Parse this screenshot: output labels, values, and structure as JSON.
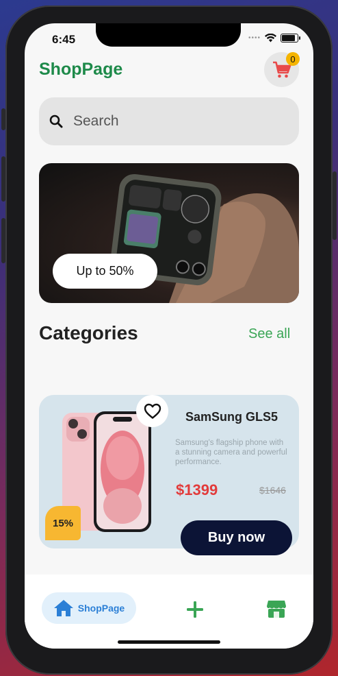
{
  "status_bar": {
    "time": "6:45"
  },
  "header": {
    "title": "ShopPage",
    "cart_count": "0"
  },
  "search": {
    "placeholder": "Search"
  },
  "banner": {
    "button_label": "Up to 50%"
  },
  "categories": {
    "title": "Categories",
    "see_all": "See all"
  },
  "product": {
    "name": "SamSung GLS5",
    "description": "Samsung's flagship phone with a stunning camera and powerful performance.",
    "price": "$1399",
    "old_price": "$1646",
    "discount": "15%",
    "buy_label": "Buy now"
  },
  "bottom_nav": {
    "home_label": "ShopPage",
    "home_icon": "home-icon",
    "add_icon": "plus-icon",
    "store_icon": "store-icon"
  },
  "colors": {
    "brand_green": "#1e8a4a",
    "link_green": "#3aa555",
    "price_red": "#e23b3b",
    "buy_button": "#0c1436",
    "badge_yellow": "#f5b400",
    "nav_blue": "#2b7fd6"
  }
}
